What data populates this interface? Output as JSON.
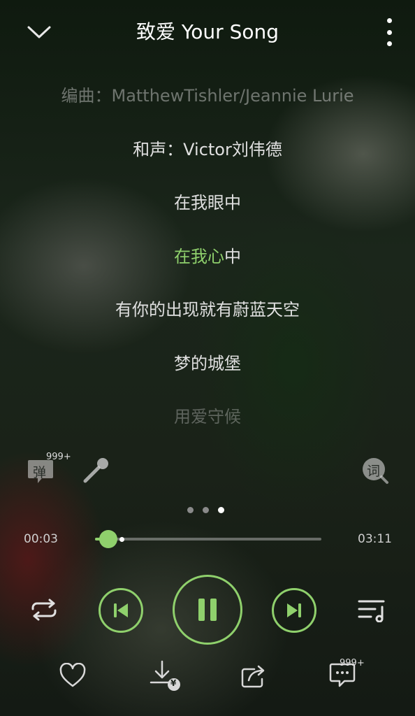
{
  "header": {
    "title": "致爱 Your Song"
  },
  "lyrics": [
    {
      "text": "编曲：MatthewTishler/Jeannie Lurie"
    },
    {
      "text": "和声：Victor刘伟德"
    },
    {
      "text": "在我眼中"
    },
    {
      "highlight": "在我心",
      "rest": "中"
    },
    {
      "text": "有你的出现就有蔚蓝天空"
    },
    {
      "text": "梦的城堡"
    },
    {
      "text": "用爱守候"
    }
  ],
  "tools": {
    "danmu_label": "弹",
    "danmu_count": "999+",
    "lyrics_label": "词"
  },
  "pager": {
    "count": 3,
    "active": 2
  },
  "progress": {
    "current": "00:03",
    "total": "03:11",
    "played_fraction": 0.06,
    "buffered_fraction": 0.12
  },
  "actions": {
    "comment_count": "999+",
    "download_badge": "¥"
  },
  "colors": {
    "accent": "#8fd06c"
  }
}
